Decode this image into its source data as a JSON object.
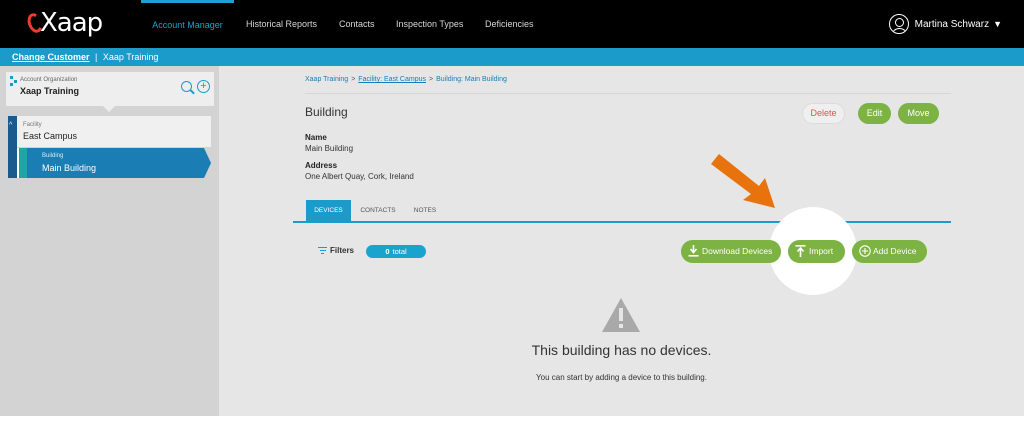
{
  "app": {
    "logo_text": "Xaap",
    "logo_accent": "#e8402a"
  },
  "nav": {
    "items": [
      {
        "label": "Account Manager",
        "active": true
      },
      {
        "label": "Historical Reports",
        "active": false
      },
      {
        "label": "Contacts",
        "active": false
      },
      {
        "label": "Inspection Types",
        "active": false
      },
      {
        "label": "Deficiencies",
        "active": false
      }
    ],
    "user_name": "Martina Schwarz",
    "user_icon": "user-icon"
  },
  "customer_bar": {
    "change_label": "Change Customer",
    "separator": "|",
    "customer_name": "Xaap Training"
  },
  "sidebar": {
    "org_label": "Account Organization",
    "org_name": "Xaap Training",
    "facility_label": "Facility",
    "facility_name": "East Campus",
    "building_label": "Building",
    "building_name": "Main Building"
  },
  "breadcrumb": {
    "root": "Xaap Training",
    "facility": "Facility: East Campus",
    "building": "Building: Main Building",
    "sep": ">"
  },
  "building": {
    "title": "Building",
    "delete_label": "Delete",
    "edit_label": "Edit",
    "move_label": "Move",
    "name_label": "Name",
    "name_value": "Main Building",
    "address_label": "Address",
    "address_value": "One Albert Quay, Cork, Ireland"
  },
  "tabs": [
    {
      "label": "DEVICES",
      "active": true
    },
    {
      "label": "CONTACTS",
      "active": false
    },
    {
      "label": "NOTES",
      "active": false
    }
  ],
  "devices": {
    "filters_label": "Filters",
    "total_count": "0",
    "total_label": "total",
    "download_label": "Download Devices",
    "import_label": "Import",
    "add_label": "Add Device",
    "empty_title": "This building has no devices.",
    "empty_sub": "You can start by adding a device to this building."
  },
  "colors": {
    "brand_blue": "#1a9bc9",
    "green": "#7cb342",
    "arrow_orange": "#e8730c"
  }
}
